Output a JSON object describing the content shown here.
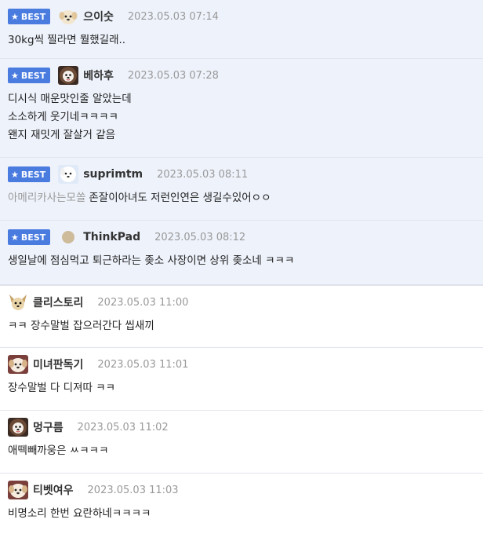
{
  "best_label": "BEST",
  "best_comments": [
    {
      "nick": "으이숫",
      "time": "2023.05.03 07:14",
      "avatar": "puppy-avatar",
      "lines": [
        "30kg씩 찔라면 뭘했길래.."
      ]
    },
    {
      "nick": "베하후",
      "time": "2023.05.03 07:28",
      "avatar": "lion-dog-avatar",
      "lines": [
        "디시식 매운맛인줄 알았는데",
        "소소하게 웃기네ㅋㅋㅋㅋ",
        "왠지 재밋게 잘살거 같음"
      ]
    },
    {
      "nick": "suprimtm",
      "time": "2023.05.03 08:11",
      "avatar": "white-dog-avatar",
      "mention": "아메리카사는모쏠",
      "lines": [
        "존잘이아녀도 저런인연은 생길수있어ㅇㅇ"
      ]
    },
    {
      "nick": "ThinkPad",
      "time": "2023.05.03 08:12",
      "avatar": "round-avatar",
      "lines": [
        "생일날에 점심먹고 퇴근하라는 좆소 사장이면 상위 좆소네 ㅋㅋㅋ"
      ]
    }
  ],
  "comments": [
    {
      "nick": "클리스토리",
      "time": "2023.05.03 11:00",
      "avatar": "chihuahua-avatar",
      "lines": [
        "ㅋㅋ 장수말벌 잡으러간다 씹새끼"
      ]
    },
    {
      "nick": "미녀판독기",
      "time": "2023.05.03 11:01",
      "avatar": "puppy-avatar",
      "lines": [
        "장수말벌 다 디져따 ㅋㅋ"
      ]
    },
    {
      "nick": "멍구름",
      "time": "2023.05.03 11:02",
      "avatar": "lion-dog-avatar",
      "lines": [
        "애떽빼까웅은 ㅆㅋㅋㅋ"
      ]
    },
    {
      "nick": "티벳여우",
      "time": "2023.05.03 11:03",
      "avatar": "puppy-avatar",
      "lines": [
        "비명소리 한번 요란하네ㅋㅋㅋㅋ"
      ]
    }
  ],
  "colors": {
    "best_bg": "#eef2fb",
    "badge": "#4a7ce0"
  }
}
